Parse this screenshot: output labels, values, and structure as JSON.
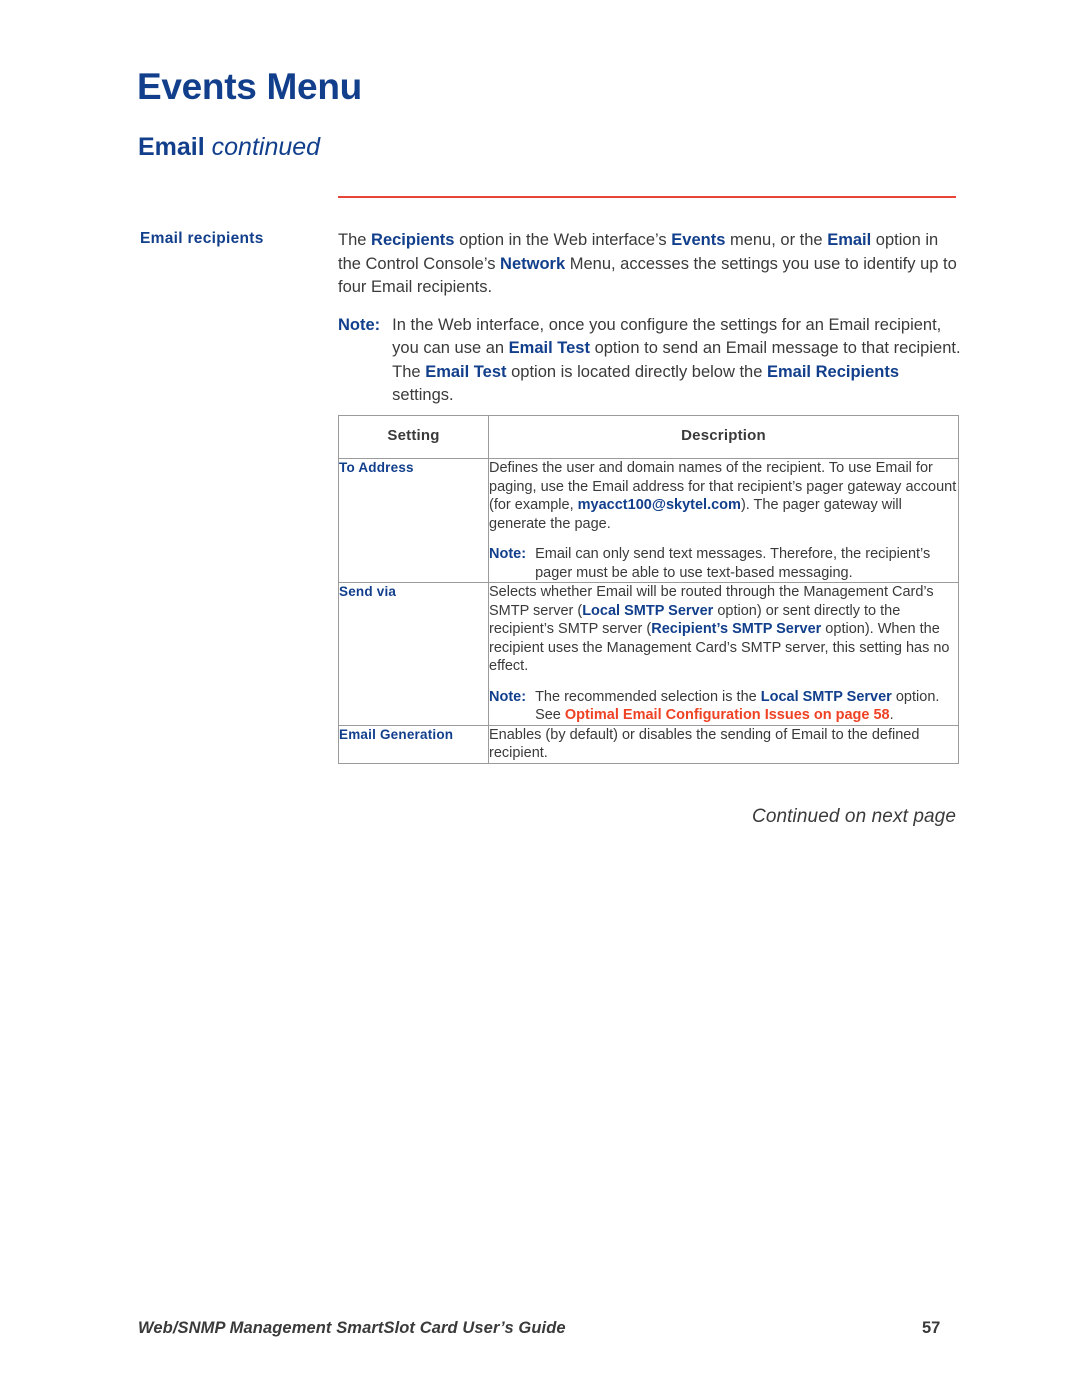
{
  "header": {
    "chapter_title": "Events Menu",
    "section_title_bold": "Email",
    "section_title_italic": "continued"
  },
  "body": {
    "side_label": "Email recipients",
    "intro": {
      "part1": "The ",
      "b1": "Recipients",
      "part2": " option in the Web interface’s ",
      "b2": "Events",
      "part3": " menu, or the ",
      "b3": "Email",
      "part4": " option in the Control Console’s ",
      "b4": "Network",
      "part5": " Menu, accesses the settings you use to identify up to four Email recipients."
    },
    "note": {
      "lead": "Note:",
      "part1": "In the Web interface, once you configure the settings for an Email recipient, you can use an ",
      "b1": "Email Test",
      "part2": " option to send an Email message to that recipient. The ",
      "b2": "Email Test",
      "part3": " option is located directly below the ",
      "b3": "Email Recipients",
      "part4": " settings."
    }
  },
  "table": {
    "columns": [
      "Setting",
      "Description"
    ],
    "rows": [
      {
        "setting": "To Address",
        "desc": {
          "part1": "Defines the user and domain names of the recipient. To use Email for paging, use the Email address for that recipient’s pager gateway account (for example, ",
          "b1": "myacct100@skytel.com",
          "part2": "). The pager gateway will generate the page."
        },
        "note": {
          "lead": "Note:",
          "text": "Email can only send text messages. Therefore, the recipient’s pager must be able to use text-based messaging."
        }
      },
      {
        "setting": "Send via",
        "desc": {
          "part1": "Selects whether Email will be routed through the Management Card’s SMTP server (",
          "b1": "Local SMTP Server",
          "part2": " option) or sent directly to the recipient’s SMTP server (",
          "b2": "Recipient’s SMTP Server",
          "part3": " option). When the recipient uses the Management Card’s SMTP server, this setting has no effect."
        },
        "note": {
          "lead": "Note:",
          "part1": "The recommended selection is the ",
          "b1": "Local SMTP Server",
          "part2": " option. See ",
          "xref": "Optimal Email Configuration Issues on page 58",
          "part3": "."
        }
      },
      {
        "setting": "Email Generation",
        "desc": {
          "part1": "Enables (by default) or disables the sending of Email to the defined recipient."
        }
      }
    ]
  },
  "continued_note": "Continued on next page",
  "footer": {
    "title": "Web/SNMP Management SmartSlot Card User’s Guide",
    "page_number": "57"
  },
  "colors": {
    "heading_blue": "#123f8c",
    "rule_red": "#e8443a",
    "xref_red": "#ef4123",
    "body_gray": "#3a3a3a",
    "table_border": "#9b9b9b"
  }
}
